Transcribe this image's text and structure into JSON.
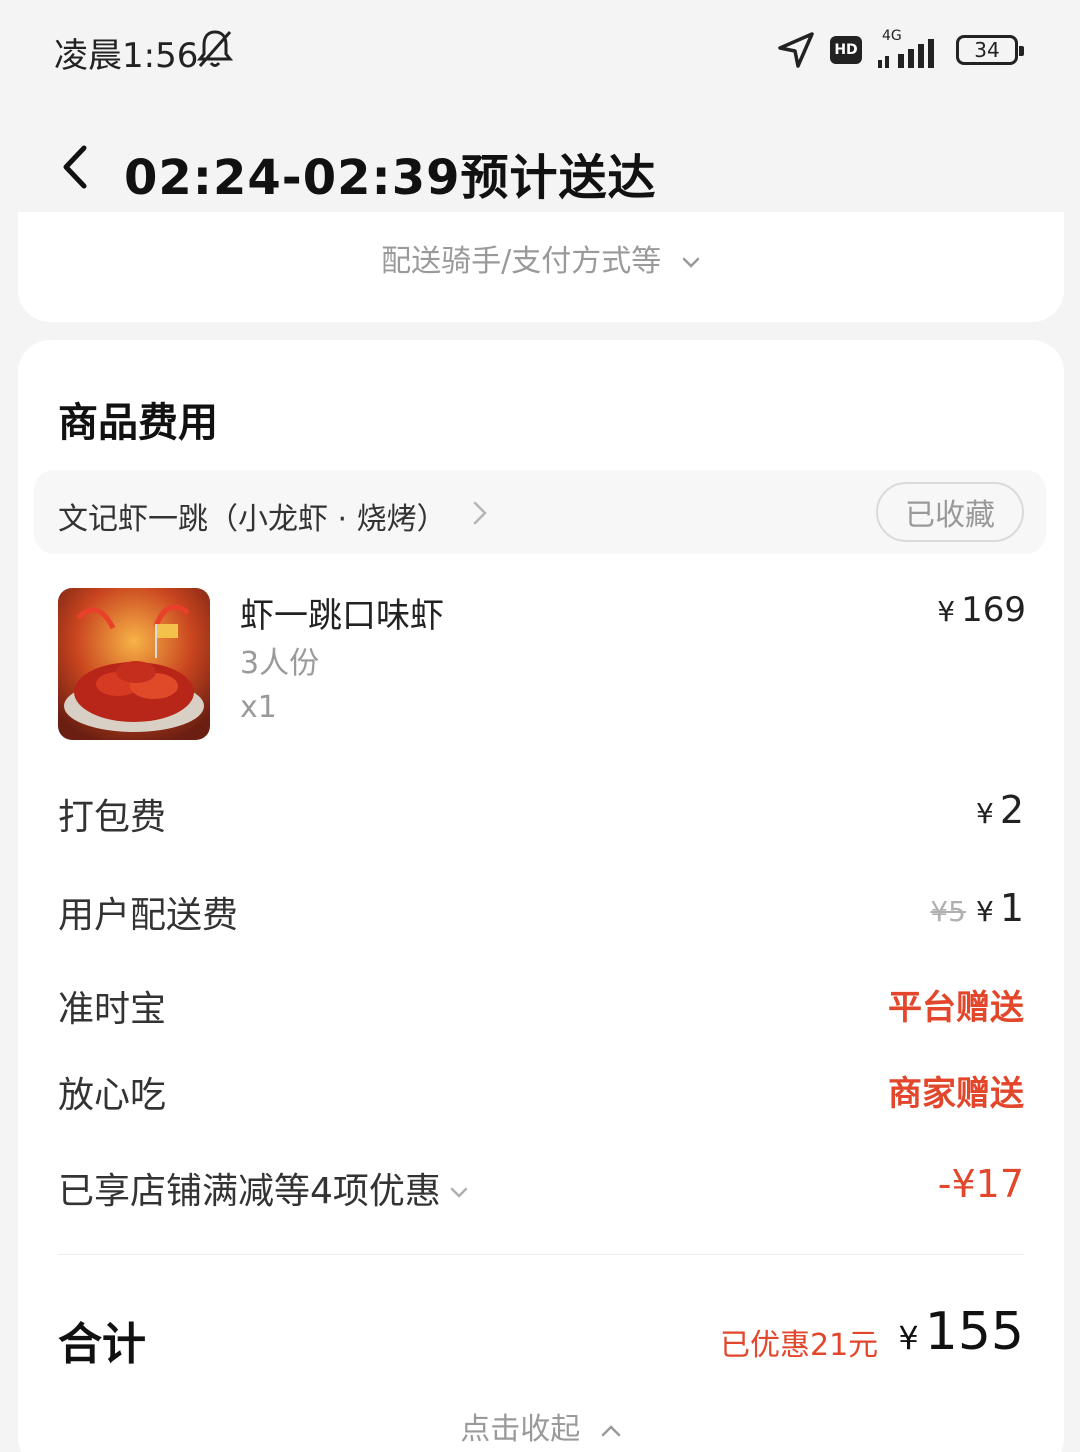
{
  "status_bar": {
    "time": "凌晨1:56",
    "network": "4G",
    "hd": "HD",
    "battery": "34"
  },
  "header": {
    "title": "02:24-02:39预计送达"
  },
  "delivery_info": {
    "expand_label": "配送骑手/支付方式等"
  },
  "order": {
    "section_title": "商品费用",
    "shop": {
      "name": "文记虾一跳（小龙虾 · 烧烤）",
      "favorite_label": "已收藏"
    },
    "item": {
      "name": "虾一跳口味虾",
      "spec": "3人份",
      "qty": "x1",
      "price_symbol": "¥",
      "price": "169"
    },
    "fees": {
      "packaging": {
        "label": "打包费",
        "symbol": "¥",
        "value": "2"
      },
      "delivery": {
        "label": "用户配送费",
        "original": "¥5",
        "symbol": "¥",
        "value": "1"
      },
      "ontime": {
        "label": "准时宝",
        "value": "平台赠送"
      },
      "safe": {
        "label": "放心吃",
        "value": "商家赠送"
      },
      "discount": {
        "label": "已享店铺满减等4项优惠",
        "value": "-¥17"
      }
    },
    "total": {
      "label": "合计",
      "saved": "已优惠21元",
      "symbol": "¥",
      "value": "155"
    },
    "collapse_label": "点击收起"
  },
  "colors": {
    "accent_red": "#e2462b",
    "muted": "#9a9a9a",
    "background": "#f4f4f4"
  }
}
